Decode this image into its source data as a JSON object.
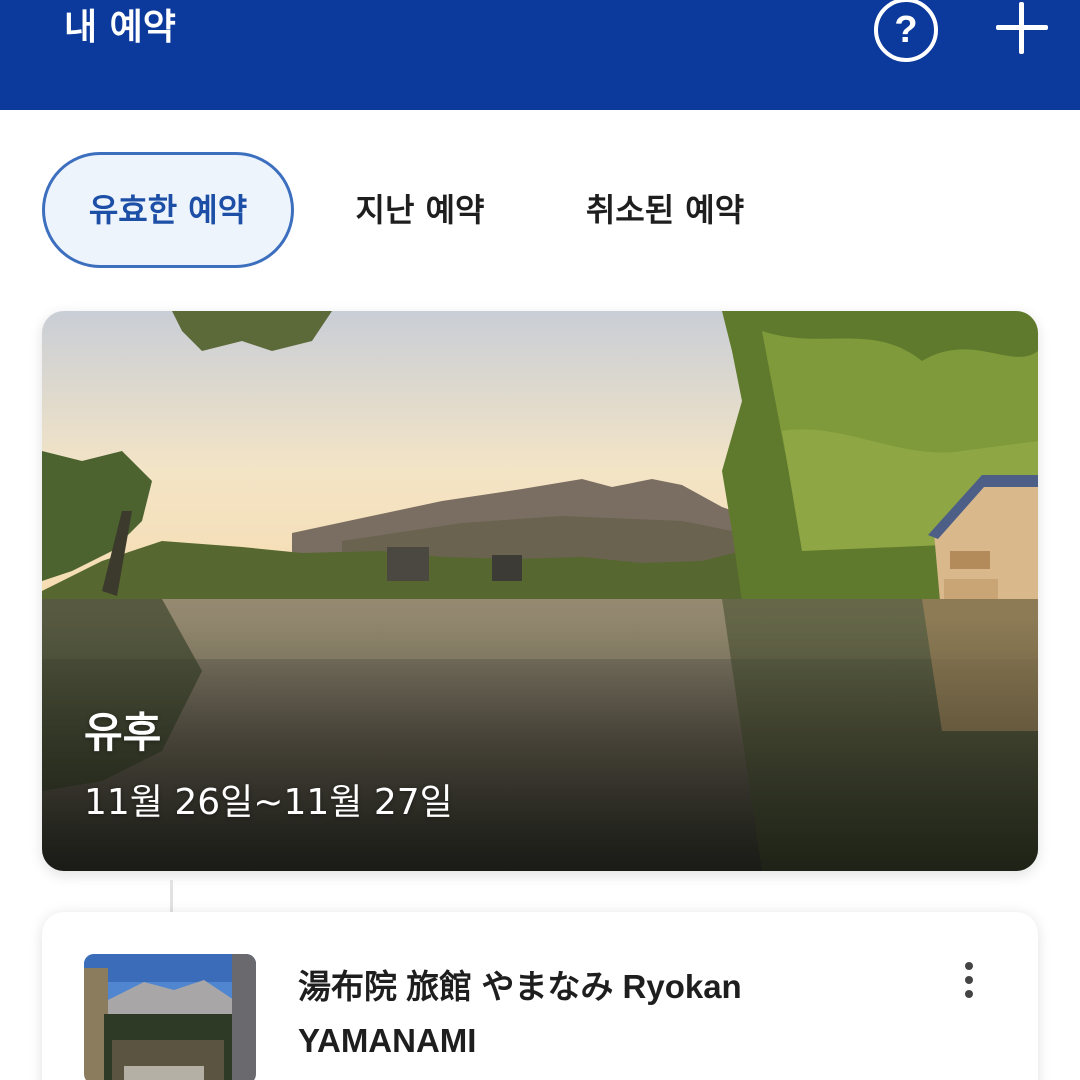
{
  "header": {
    "title": "내 예약",
    "help_icon_glyph": "?",
    "help_icon": "help-circle-icon",
    "add_icon": "plus-icon",
    "background": "#0c3a9c"
  },
  "tabs": [
    {
      "label": "유효한 예약",
      "active": true
    },
    {
      "label": "지난 예약",
      "active": false
    },
    {
      "label": "취소된 예약",
      "active": false
    }
  ],
  "trip": {
    "destination": "유후",
    "dates": "11월 26일~11월 27일"
  },
  "booking": {
    "name": "湯布院 旅館 やまなみ Ryokan YAMANAMI",
    "menu_icon": "more-vertical-icon"
  },
  "colors": {
    "accent": "#1d4fa6",
    "active_tab_bg": "#eef4fc",
    "active_tab_border": "#3d6fbf"
  }
}
